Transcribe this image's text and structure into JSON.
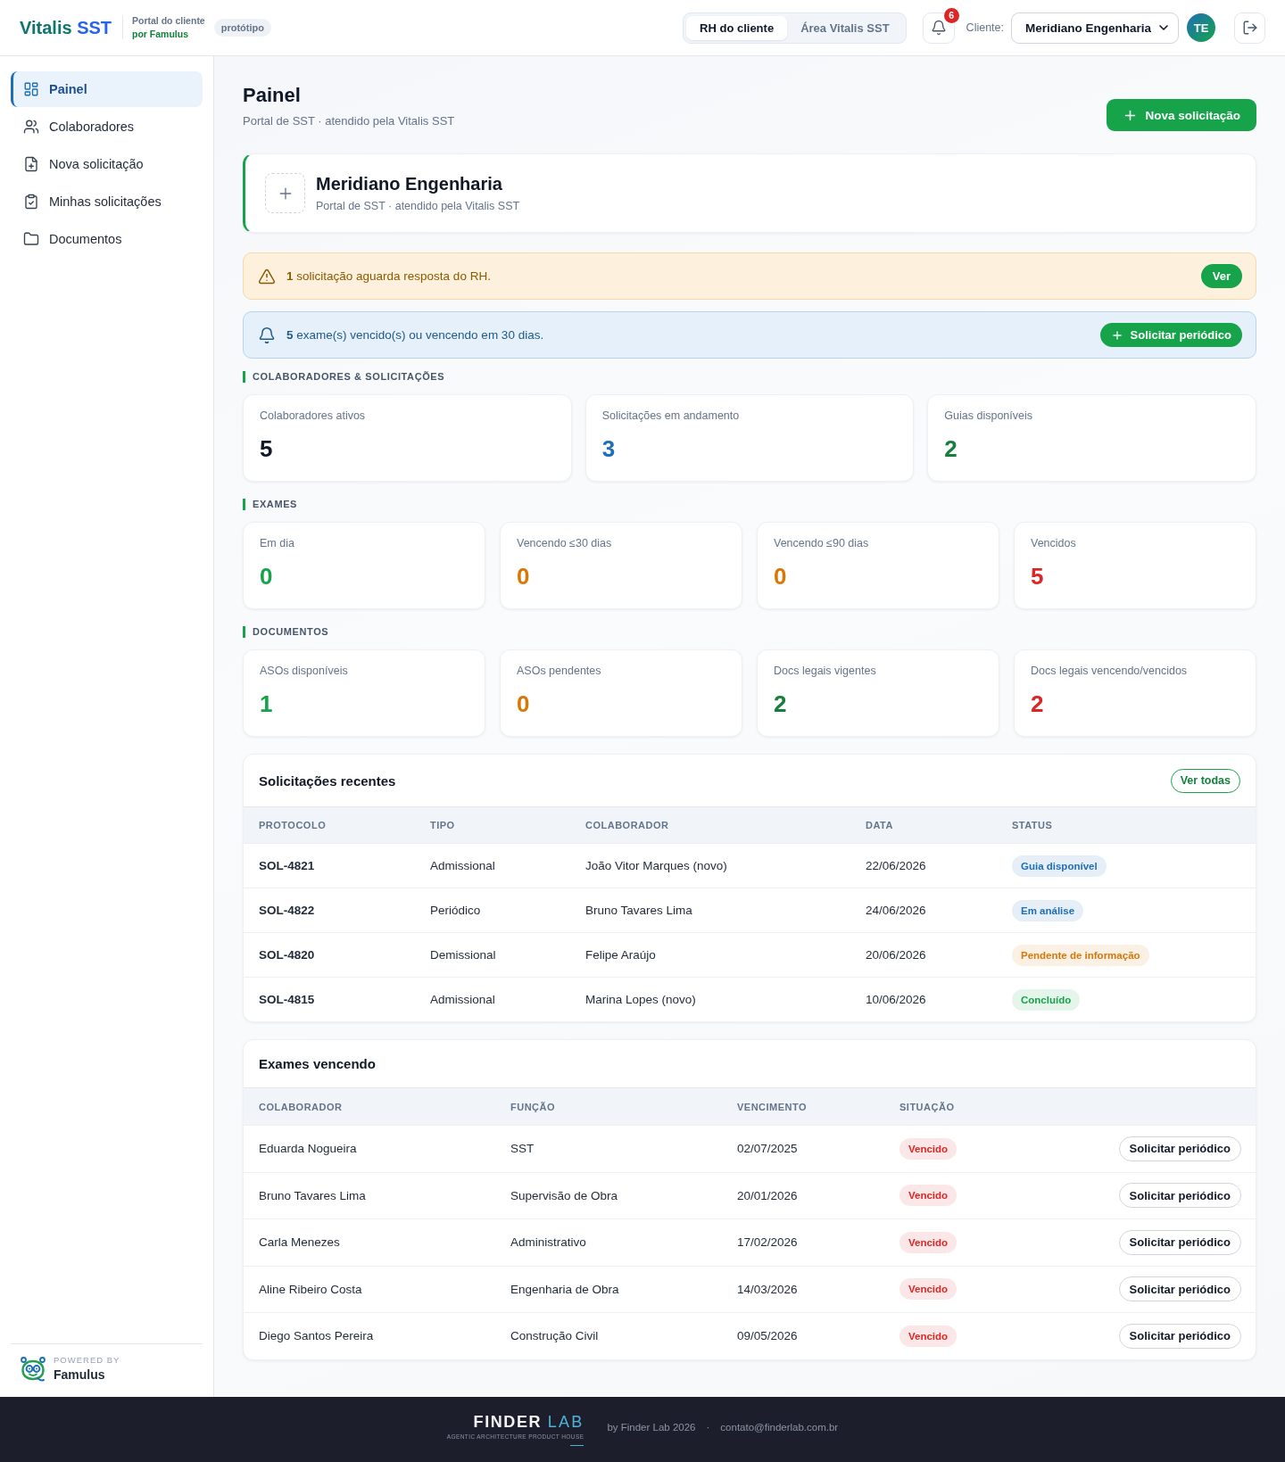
{
  "header": {
    "brand": {
      "name": "Vitalis",
      "accent": "SST"
    },
    "portal_label": "Portal do cliente",
    "portal_by": "por Famulus",
    "badge": "protótipo",
    "view_tabs": [
      {
        "label": "RH do cliente",
        "selected": true
      },
      {
        "label": "Área Vitalis SST",
        "selected": false
      }
    ],
    "notification_count": "6",
    "client_label": "Cliente:",
    "client_select": {
      "value": "Meridiano Engenharia"
    },
    "avatar_initials": "TE"
  },
  "sidebar": {
    "items": [
      {
        "label": "Painel",
        "selected": true
      },
      {
        "label": "Colaboradores",
        "selected": false
      },
      {
        "label": "Nova solicitação",
        "selected": false
      },
      {
        "label": "Minhas solicitações",
        "selected": false
      },
      {
        "label": "Documentos",
        "selected": false
      }
    ],
    "powered_by": {
      "label": "POWERED BY",
      "name": "Famulus"
    }
  },
  "page": {
    "title": "Painel",
    "subtitle": "Portal de SST · atendido pela Vitalis SST",
    "primary_action": "Nova solicitação"
  },
  "client_card": {
    "name": "Meridiano Engenharia",
    "subtitle": "Portal de SST · atendido pela Vitalis SST"
  },
  "alerts": [
    {
      "kind": "warning",
      "text": "**1** solicitação aguarda resposta do RH.",
      "action": "Ver"
    },
    {
      "kind": "info",
      "text": "**5** exame(s) vencido(s) ou vencendo em 30 dias.",
      "action": "Solicitar periódico"
    }
  ],
  "sections": [
    {
      "title": "COLABORADORES & SOLICITAÇÕES",
      "stats": [
        {
          "label": "Colaboradores ativos",
          "value": "5",
          "color": "#111827"
        },
        {
          "label": "Solicitações em andamento",
          "value": "3",
          "color": "#1d6fb8"
        },
        {
          "label": "Guias disponíveis",
          "value": "2",
          "color": "#15803d"
        }
      ]
    },
    {
      "title": "EXAMES",
      "stats": [
        {
          "label": "Em dia",
          "value": "0",
          "color": "#16a34a"
        },
        {
          "label": "Vencendo ≤30 dias",
          "value": "0",
          "color": "#d97706"
        },
        {
          "label": "Vencendo ≤90 dias",
          "value": "0",
          "color": "#d97706"
        },
        {
          "label": "Vencidos",
          "value": "5",
          "color": "#dc2626"
        }
      ]
    },
    {
      "title": "DOCUMENTOS",
      "stats": [
        {
          "label": "ASOs disponíveis",
          "value": "1",
          "color": "#16a34a"
        },
        {
          "label": "ASOs pendentes",
          "value": "0",
          "color": "#d97706"
        },
        {
          "label": "Docs legais vigentes",
          "value": "2",
          "color": "#15803d"
        },
        {
          "label": "Docs legais vencendo/vencidos",
          "value": "2",
          "color": "#dc2626"
        }
      ]
    }
  ],
  "recent_requests": {
    "title": "Solicitações recentes",
    "action": "Ver todas",
    "columns": [
      "PROTOCOLO",
      "TIPO",
      "COLABORADOR",
      "DATA",
      "STATUS"
    ],
    "rows": [
      {
        "protocol": "SOL-4821",
        "type": "Admissional",
        "employee": "João Vitor Marques (novo)",
        "date": "22/06/2026",
        "status": {
          "label": "Guia disponível",
          "color": "#1d6fb8"
        }
      },
      {
        "protocol": "SOL-4822",
        "type": "Periódico",
        "employee": "Bruno Tavares Lima",
        "date": "24/06/2026",
        "status": {
          "label": "Em análise",
          "color": "#1d6fb8"
        }
      },
      {
        "protocol": "SOL-4820",
        "type": "Demissional",
        "employee": "Felipe Araújo",
        "date": "20/06/2026",
        "status": {
          "label": "Pendente de informação",
          "color": "#d97706"
        }
      },
      {
        "protocol": "SOL-4815",
        "type": "Admissional",
        "employee": "Marina Lopes (novo)",
        "date": "10/06/2026",
        "status": {
          "label": "Concluído",
          "color": "#16a34a"
        }
      }
    ]
  },
  "expiring_exams": {
    "title": "Exames vencendo",
    "columns": [
      "COLABORADOR",
      "FUNÇÃO",
      "VENCIMENTO",
      "SITUAÇÃO"
    ],
    "rows": [
      {
        "employee": "Eduarda Nogueira",
        "role": "SST",
        "due": "02/07/2025",
        "status": {
          "label": "Vencido",
          "color": "#dc2626"
        },
        "action": "Solicitar periódico"
      },
      {
        "employee": "Bruno Tavares Lima",
        "role": "Supervisão de Obra",
        "due": "20/01/2026",
        "status": {
          "label": "Vencido",
          "color": "#dc2626"
        },
        "action": "Solicitar periódico"
      },
      {
        "employee": "Carla Menezes",
        "role": "Administrativo",
        "due": "17/02/2026",
        "status": {
          "label": "Vencido",
          "color": "#dc2626"
        },
        "action": "Solicitar periódico"
      },
      {
        "employee": "Aline Ribeiro Costa",
        "role": "Engenharia de Obra",
        "due": "14/03/2026",
        "status": {
          "label": "Vencido",
          "color": "#dc2626"
        },
        "action": "Solicitar periódico"
      },
      {
        "employee": "Diego Santos Pereira",
        "role": "Construção Civil",
        "due": "09/05/2026",
        "status": {
          "label": "Vencido",
          "color": "#dc2626"
        },
        "action": "Solicitar periódico"
      }
    ]
  },
  "footer": {
    "logo": {
      "word": "FINDER",
      "accent": "LAB",
      "tagline": "AGENTIC ARCHITECTURE PRODUCT HOUSE"
    },
    "credit": "by Finder Lab 2026",
    "separator": "·",
    "email": "contato@finderlab.com.br"
  }
}
